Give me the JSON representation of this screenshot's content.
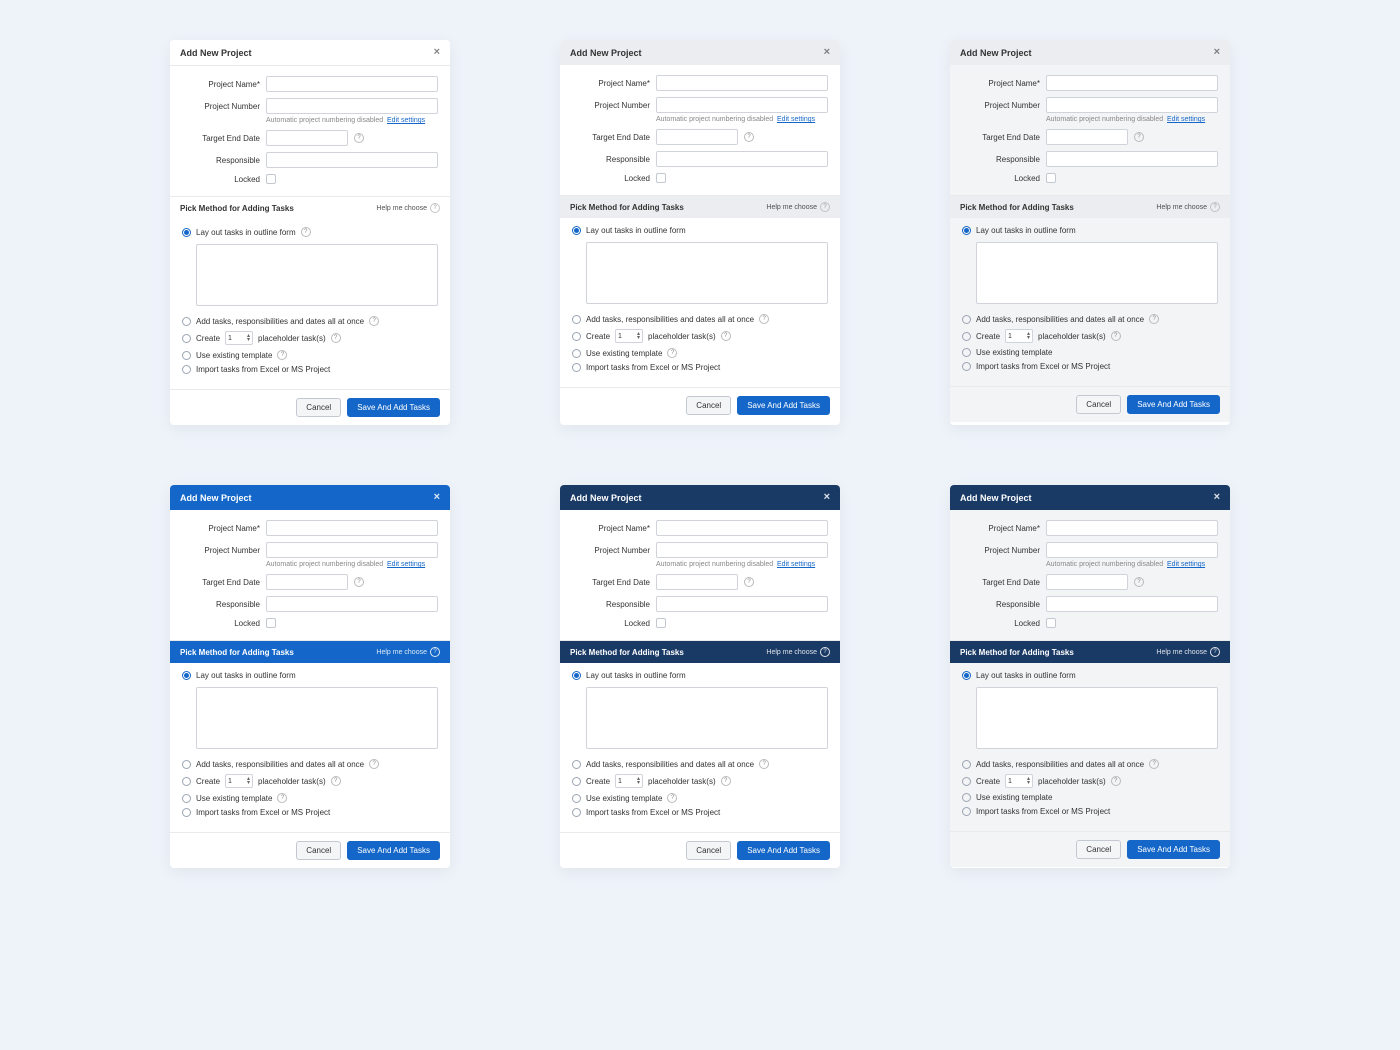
{
  "title": "Add New Project",
  "labels": {
    "projectName": "Project Name*",
    "projectNumber": "Project Number",
    "targetEnd": "Target End Date",
    "responsible": "Responsible",
    "locked": "Locked"
  },
  "note": {
    "text": "Automatic project numbering disabled",
    "link": "Edit settings"
  },
  "section": {
    "title": "Pick Method for Adding Tasks",
    "help": "Help me choose"
  },
  "options": {
    "outline": "Lay out tasks in outline form",
    "allAtOnce": "Add tasks, responsibilities and dates all at once",
    "createA": "Create",
    "createB": "placeholder task(s)",
    "stepperValue": "1",
    "template": "Use existing template",
    "import": "Import tasks from Excel or MS Project"
  },
  "buttons": {
    "cancel": "Cancel",
    "save": "Save And Add Tasks"
  }
}
